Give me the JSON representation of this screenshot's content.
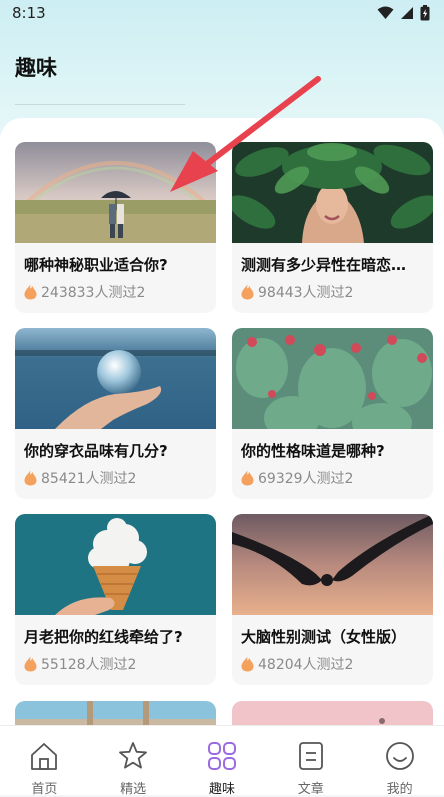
{
  "status_bar": {
    "time": "8:13"
  },
  "header": {
    "title": "趣味"
  },
  "cards": [
    {
      "title": "哪种神秘职业适合你?",
      "count_text": "243833人测过2",
      "image": "rainbow-couple-umbrella"
    },
    {
      "title": "测测有多少异性在暗恋…",
      "count_text": "98443人测过2",
      "image": "woman-leaves-face"
    },
    {
      "title": "你的穿衣品味有几分?",
      "count_text": "85421人测过2",
      "image": "hand-crystal-ball"
    },
    {
      "title": "你的性格味道是哪种?",
      "count_text": "69329人测过2",
      "image": "cactus-flowers"
    },
    {
      "title": "月老把你的红线牵给了?",
      "count_text": "55128人测过2",
      "image": "ice-cream-cloud"
    },
    {
      "title": "大脑性别测试（女性版）",
      "count_text": "48204人测过2",
      "image": "holding-hands-sunset"
    }
  ],
  "bottom_nav": [
    {
      "label": "首页",
      "icon": "home-icon",
      "active": false
    },
    {
      "label": "精选",
      "icon": "star-icon",
      "active": false
    },
    {
      "label": "趣味",
      "icon": "grid-icon",
      "active": true
    },
    {
      "label": "文章",
      "icon": "article-icon",
      "active": false
    },
    {
      "label": "我的",
      "icon": "profile-icon",
      "active": false
    }
  ],
  "colors": {
    "accent": "#9b6be0",
    "flame": "#f4a15e",
    "annotation_arrow": "#e8424e"
  }
}
